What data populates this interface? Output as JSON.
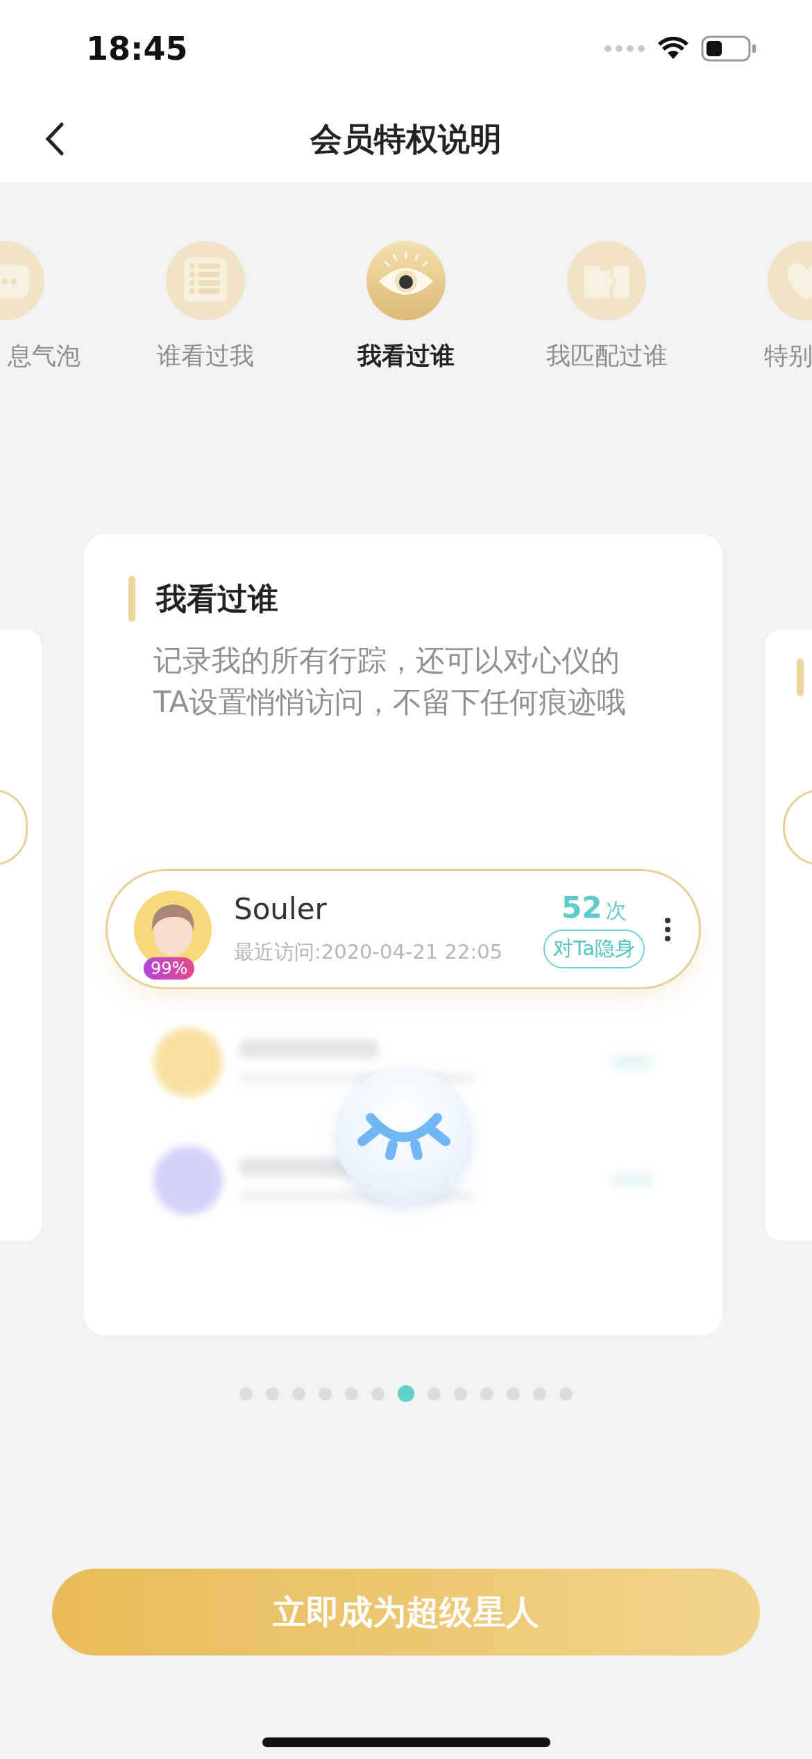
{
  "status_bar": {
    "time": "18:45"
  },
  "nav": {
    "title": "会员特权说明"
  },
  "privileges": [
    {
      "kind": "bubble",
      "label": "息气泡",
      "selected": false
    },
    {
      "kind": "list",
      "label": "谁看过我",
      "selected": false
    },
    {
      "kind": "eye",
      "label": "我看过谁",
      "selected": true
    },
    {
      "kind": "puzzle",
      "label": "我匹配过谁",
      "selected": false
    },
    {
      "kind": "heart",
      "label": "特别",
      "selected": false
    }
  ],
  "card": {
    "title": "我看过谁",
    "description": "记录我的所有行踪，还可以对心仪的TA设置悄悄访问，不留下任何痕迹哦",
    "visitor": {
      "name": "Souler",
      "match": "99%",
      "last_visit": "最近访问:2020-04-21 22:05",
      "count": "52",
      "count_unit": "次",
      "action": "对Ta隐身"
    }
  },
  "pager": [
    {
      "selected": false
    },
    {
      "selected": false
    },
    {
      "selected": false
    },
    {
      "selected": false
    },
    {
      "selected": false
    },
    {
      "selected": false
    },
    {
      "selected": true
    },
    {
      "selected": false
    },
    {
      "selected": false
    },
    {
      "selected": false
    },
    {
      "selected": false
    },
    {
      "selected": false
    },
    {
      "selected": false
    }
  ],
  "cta": {
    "label": "立即成为超级星人"
  }
}
